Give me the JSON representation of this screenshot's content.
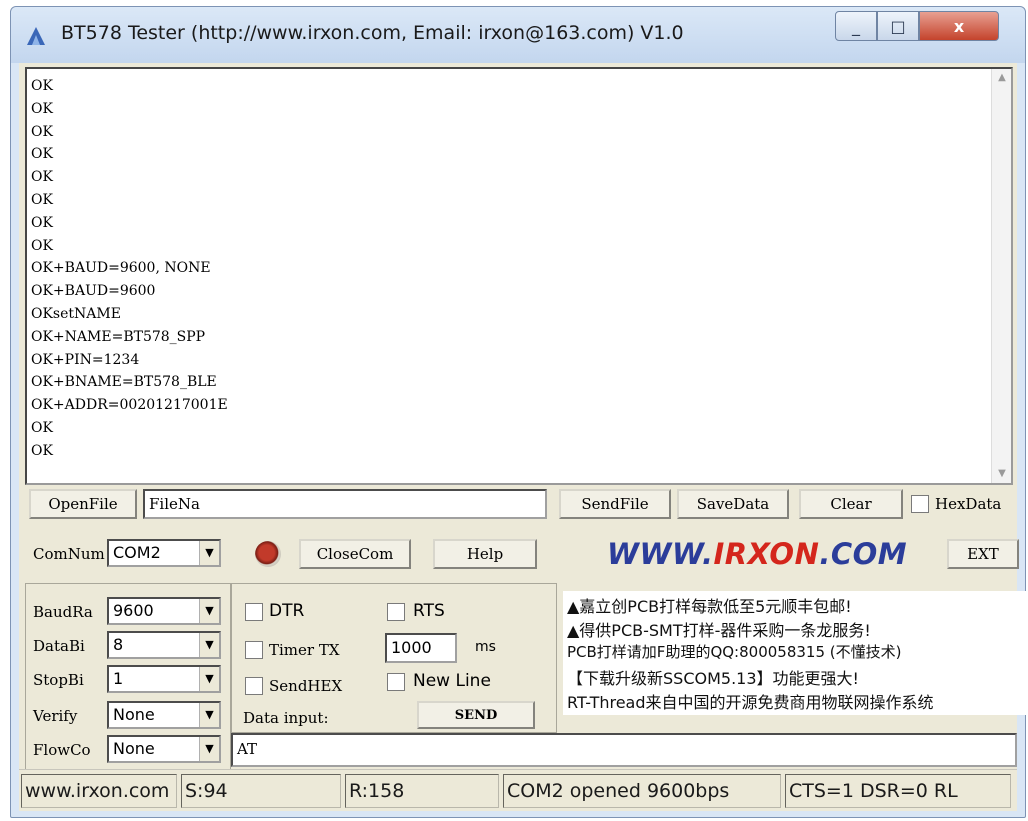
{
  "window": {
    "title": "BT578 Tester (http://www.irxon.com, Email: irxon@163.com) V1.0",
    "minimize_glyph": "_",
    "maximize_glyph": "□",
    "close_glyph": "x"
  },
  "receive": {
    "lines": [
      "OK",
      "OK",
      "OK",
      "OK",
      "OK",
      "OK",
      "OK",
      "OK",
      "OK+BAUD=9600, NONE",
      "OK+BAUD=9600",
      "OKsetNAME",
      "OK+NAME=BT578_SPP",
      "OK+PIN=1234",
      "OK+BNAME=BT578_BLE",
      "OK+ADDR=00201217001E",
      "OK",
      "OK"
    ]
  },
  "file_row": {
    "open_file": "OpenFile",
    "file_name": "FileNa",
    "send_file": "SendFile",
    "save_data": "SaveData",
    "clear": "Clear",
    "hex_data": "HexData"
  },
  "com_row": {
    "com_num_label": "ComNum",
    "com_port": "COM2",
    "close_com": "CloseCom",
    "help": "Help",
    "logo_prefix": "WWW.",
    "logo_brand": "IRXON",
    "logo_suffix": ".COM",
    "ext": "EXT"
  },
  "settings": {
    "baud_label": "BaudRa",
    "baud_value": "9600",
    "databits_label": "DataBi",
    "databits_value": "8",
    "stopbits_label": "StopBi",
    "stopbits_value": "1",
    "verify_label": "Verify",
    "verify_value": "None",
    "flow_label": "FlowCo",
    "flow_value": "None"
  },
  "options": {
    "dtr": "DTR",
    "rts": "RTS",
    "timer_tx": "Timer TX",
    "timer_value": "1000",
    "timer_unit": "ms",
    "send_hex": "SendHEX",
    "new_line": "New Line",
    "data_input_label": "Data input:",
    "send": "SEND",
    "input_value": "AT"
  },
  "ads": [
    "▲嘉立创PCB打样每款低至5元顺丰包邮!",
    "▲得供PCB-SMT打样-器件采购一条龙服务!",
    "PCB打样请加F助理的QQ:800058315 (不懂技术)",
    "【下载升级新SSCOM5.13】功能更强大!",
    "RT-Thread来自中国的开源免费商用物联网操作系统"
  ],
  "status": {
    "site": "www.irxon.com",
    "sent": "S:94",
    "received": "R:158",
    "port_state": "COM2 opened 9600bps",
    "lines": "CTS=1 DSR=0 RL"
  },
  "colors": {
    "logo_blue": "#2b3d9a",
    "logo_red": "#d4261c",
    "led_red": "#c23a2a"
  }
}
